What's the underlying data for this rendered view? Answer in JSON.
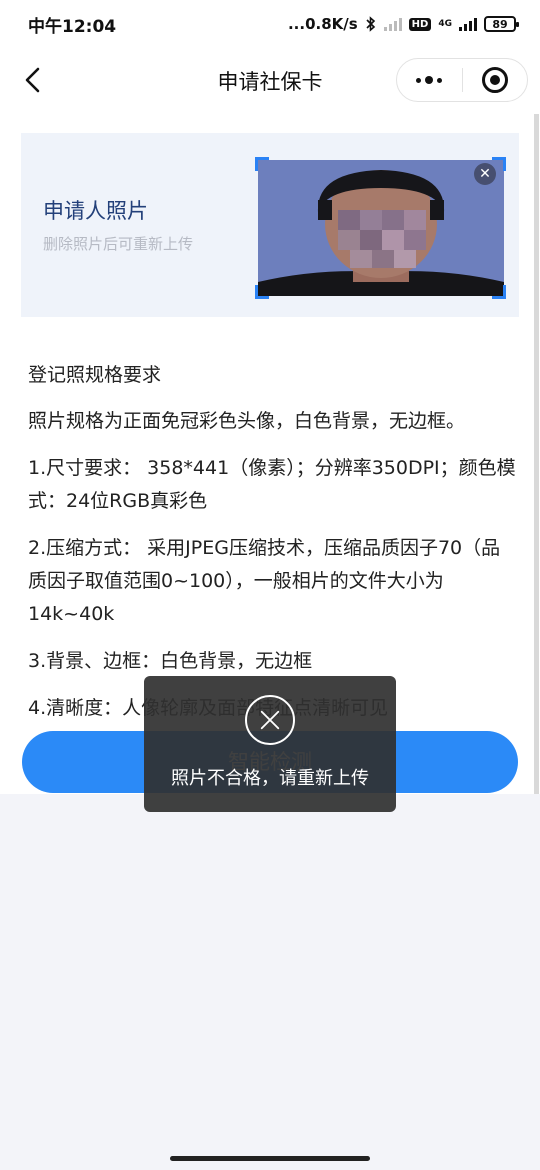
{
  "status_bar": {
    "time": "中午12:04",
    "network_speed": "...0.8K/s",
    "hd_badge": "HD",
    "network_type": "4G",
    "battery": "89"
  },
  "nav": {
    "title": "申请社保卡",
    "back_icon": "chevron-left-icon",
    "more_icon": "more-dots-icon",
    "close_icon": "target-circle-icon"
  },
  "photo_section": {
    "label": "申请人照片",
    "hint": "删除照片后可重新上传",
    "close_icon": "close-icon",
    "photo_bg_color": "#6a7cb9"
  },
  "spec": {
    "heading": "登记照规格要求",
    "items": [
      "照片规格为正面免冠彩色头像，白色背景，无边框。",
      "1.尺寸要求： 358*441（像素）；分辨率350DPI；颜色模式：24位RGB真彩色",
      "2.压缩方式： 采用JPEG压缩技术，压缩品质因子70（品质因子取值范围0~100），一般相片的文件大小为14k~40k",
      "3.背景、边框：白色背景，无边框",
      "4.清晰度：人像轮廓及面部特征点清晰可见"
    ]
  },
  "detect_button": {
    "label": "智能检测",
    "color": "#2b8af7"
  },
  "toast": {
    "message": "照片不合格，请重新上传",
    "icon": "close-circle-icon"
  }
}
